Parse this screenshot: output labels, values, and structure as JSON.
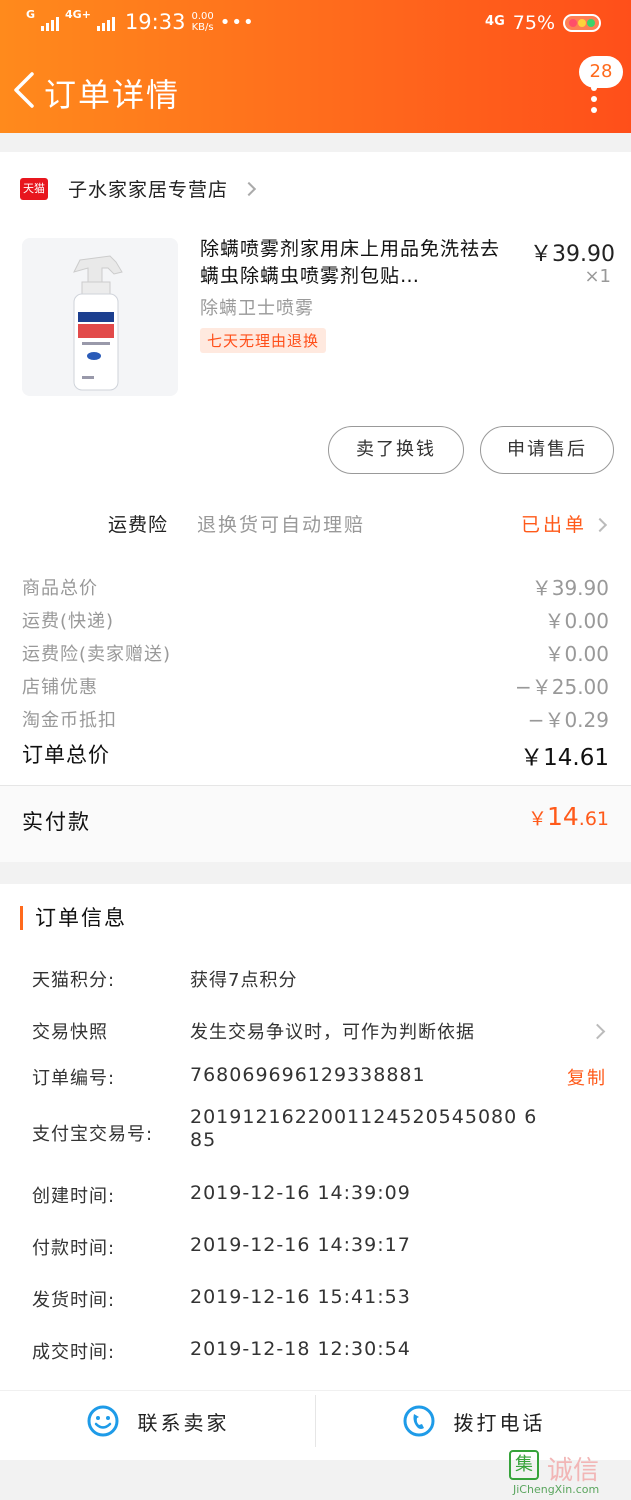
{
  "status_bar": {
    "net1": "G",
    "net2": "4G+",
    "time": "19:33",
    "speed_value": "0.00",
    "speed_unit": "KB/s",
    "dots": "•••",
    "net_right": "4G",
    "battery": "75%"
  },
  "header": {
    "title": "订单详情",
    "badge_count": "28"
  },
  "shop": {
    "logo_text": "天猫",
    "name": "子水家家居专营店"
  },
  "product": {
    "title": "除螨喷雾剂家用床上用品免洗祛去螨虫除螨虫喷雾剂包贴…",
    "price": "￥39.90",
    "qty": "×1",
    "sku": "除螨卫士喷雾",
    "tag": "七天无理由退换",
    "image_label": "除螨卫士喷雾"
  },
  "buttons": {
    "sell": "卖了换钱",
    "after_sales": "申请售后"
  },
  "freight_insurance": {
    "label": "运费险",
    "desc": "退换货可自动理赔",
    "status": "已出单"
  },
  "price_rows": [
    {
      "label": "商品总价",
      "value": "￥39.90"
    },
    {
      "label": "运费(快递)",
      "value": "￥0.00"
    },
    {
      "label": "运费险(卖家赠送)",
      "value": "￥0.00"
    },
    {
      "label": "店铺优惠",
      "value": "−￥25.00"
    },
    {
      "label": "淘金币抵扣",
      "value": "−￥0.29"
    }
  ],
  "order_total": {
    "label": "订单总价",
    "value": "￥14.61"
  },
  "paid": {
    "label": "实付款",
    "currency": "￥",
    "integer": "14",
    "decimal": ".61"
  },
  "order_info": {
    "title": "订单信息",
    "points_label": "天猫积分:",
    "points_value": "获得7点积分",
    "snapshot_label": "交易快照",
    "snapshot_value": "发生交易争议时，可作为判断依据",
    "order_no_label": "订单编号:",
    "order_no_value": "768069696129338881",
    "copy_label": "复制",
    "alipay_label": "支付宝交易号:",
    "alipay_value_line1": "2019121622001124520545080 6",
    "alipay_value_line2": "85",
    "created_label": "创建时间:",
    "created_value": "2019-12-16 14:39:09",
    "paid_label": "付款时间:",
    "paid_value": "2019-12-16 14:39:17",
    "shipped_label": "发货时间:",
    "shipped_value": "2019-12-16 15:41:53",
    "closed_label": "成交时间:",
    "closed_value": "2019-12-18 12:30:54"
  },
  "actions": {
    "contact_seller": "联系卖家",
    "call": "拨打电话"
  },
  "watermark": {
    "logo": "集",
    "text": "诚信",
    "url": "JiChengXin.com"
  },
  "colors": {
    "accent": "#ff6a1c",
    "price_highlight": "#ff5a1a",
    "icon_blue": "#1e9be8"
  }
}
